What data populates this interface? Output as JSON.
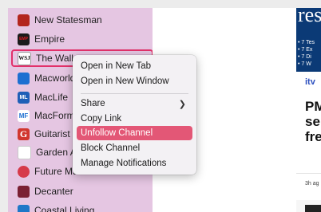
{
  "sidebar": {
    "channels": [
      {
        "name": "New Statesman",
        "logo_text": "",
        "logo_color": "#b3261e"
      },
      {
        "name": "Empire",
        "logo_text": "EMP",
        "logo_color": "#c4161c"
      },
      {
        "name": "The Wall",
        "logo_text": "WSJ",
        "logo_color": "#ffffff"
      },
      {
        "name": "Macworld",
        "logo_text": "",
        "logo_color": "#1d6fd1"
      },
      {
        "name": "MacLife",
        "logo_text": "ML",
        "logo_color": "#1f5fb7"
      },
      {
        "name": "MacFormat",
        "logo_text": "MF",
        "logo_color": "#ffffff"
      },
      {
        "name": "Guitarist",
        "logo_text": "G",
        "logo_color": "#d1372f"
      },
      {
        "name": "Garden Answers",
        "logo_text": "",
        "logo_color": "#ffffff"
      },
      {
        "name": "Future Music",
        "logo_text": "",
        "logo_color": "#d63a4a"
      },
      {
        "name": "Decanter",
        "logo_text": "",
        "logo_color": "#7a2033"
      },
      {
        "name": "Coastal Living",
        "logo_text": "",
        "logo_color": "#1f78c8"
      }
    ],
    "selected_channel": "The Wall"
  },
  "context_menu": {
    "items": [
      {
        "label": "Open in New Tab"
      },
      {
        "label": "Open in New Window"
      },
      {
        "label": "Share",
        "has_submenu": true
      },
      {
        "label": "Copy Link"
      },
      {
        "label": "Unfollow Channel",
        "highlighted": true
      },
      {
        "label": "Block Channel"
      },
      {
        "label": "Manage Notifications"
      }
    ]
  },
  "right_panel": {
    "thumb_title": "res",
    "thumb_lines": [
      "• 7 Tes",
      "• 7 Ex",
      "• 7 Di",
      "• 7 W"
    ],
    "source": "itv",
    "headline": "PM\nse\nfre",
    "time_ago": "3h ag"
  }
}
